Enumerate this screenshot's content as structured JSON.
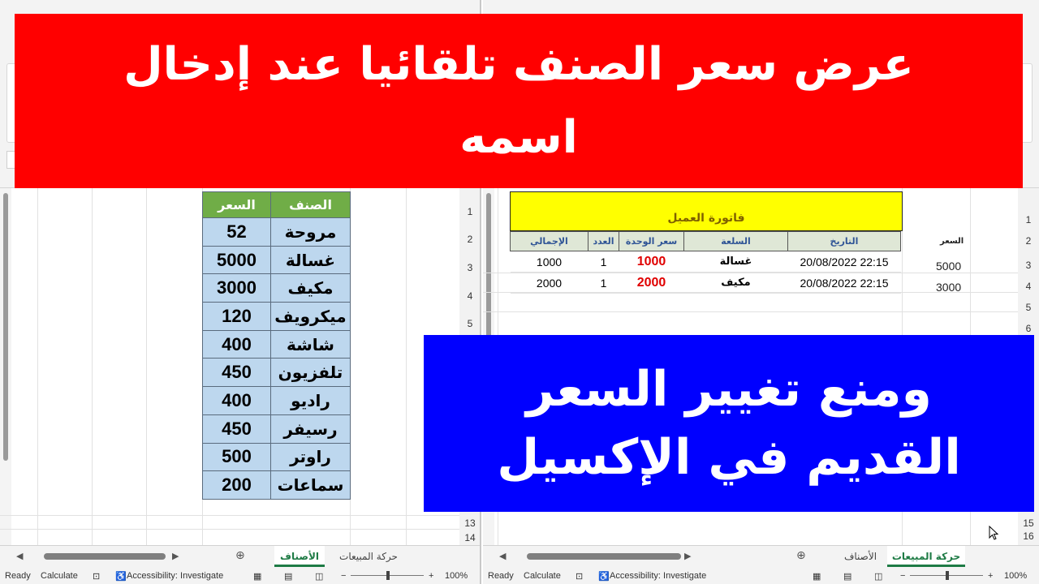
{
  "banners": {
    "top_text": "عرض سعر الصنف تلقائيا عند إدخال اسمه",
    "bottom_text": "ومنع تغيير السعر القديم في الإكسيل",
    "top_color": "#ff0000",
    "bottom_color": "#0000ff"
  },
  "left_sheet": {
    "row_numbers": [
      "1",
      "2",
      "3",
      "4",
      "5",
      "13",
      "14"
    ],
    "items_table": {
      "headers": {
        "item": "الصنف",
        "price": "السعر"
      },
      "rows": [
        {
          "item": "مروحة",
          "price": "52"
        },
        {
          "item": "غسالة",
          "price": "5000"
        },
        {
          "item": "مكيف",
          "price": "3000"
        },
        {
          "item": "ميكرويف",
          "price": "120"
        },
        {
          "item": "شاشة",
          "price": "400"
        },
        {
          "item": "تلفزيون",
          "price": "450"
        },
        {
          "item": "راديو",
          "price": "400"
        },
        {
          "item": "رسيفر",
          "price": "450"
        },
        {
          "item": "راوتر",
          "price": "500"
        },
        {
          "item": "سماعات",
          "price": "200"
        }
      ]
    },
    "tabs": [
      {
        "label": "الأصناف",
        "active": true
      },
      {
        "label": "حركة المبيعات",
        "active": false
      }
    ],
    "status": {
      "ready": "Ready",
      "calculate": "Calculate",
      "accessibility": "Accessibility: Investigate",
      "zoom": "100%"
    }
  },
  "right_sheet": {
    "row_numbers": [
      "1",
      "2",
      "3",
      "4",
      "5",
      "6",
      "15",
      "16"
    ],
    "invoice": {
      "title": "فاتورة العميل",
      "headers": {
        "date": "التاريخ",
        "product": "السلعة",
        "unit_price": "سعر الوحدة",
        "qty": "العدد",
        "total": "الإجمالي"
      },
      "rows": [
        {
          "date": "20/08/2022 22:15",
          "product": "غسالة",
          "unit_price": "1000",
          "qty": "1",
          "total": "1000"
        },
        {
          "date": "20/08/2022 22:15",
          "product": "مكيف",
          "unit_price": "2000",
          "qty": "1",
          "total": "2000"
        }
      ]
    },
    "side_column": {
      "header": "السعر",
      "values": [
        "5000",
        "3000"
      ]
    },
    "tabs": [
      {
        "label": "حركة المبيعات",
        "active": true
      },
      {
        "label": "الأصناف",
        "active": false
      }
    ],
    "status": {
      "ready": "Ready",
      "calculate": "Calculate",
      "accessibility": "Accessibility: Investigate",
      "zoom": "100%"
    }
  },
  "colors": {
    "header_green": "#70ad47",
    "cell_blue": "#bdd7ee",
    "invoice_yellow": "#ffff00",
    "price_red": "#e00000",
    "tab_green": "#1e7b45"
  }
}
